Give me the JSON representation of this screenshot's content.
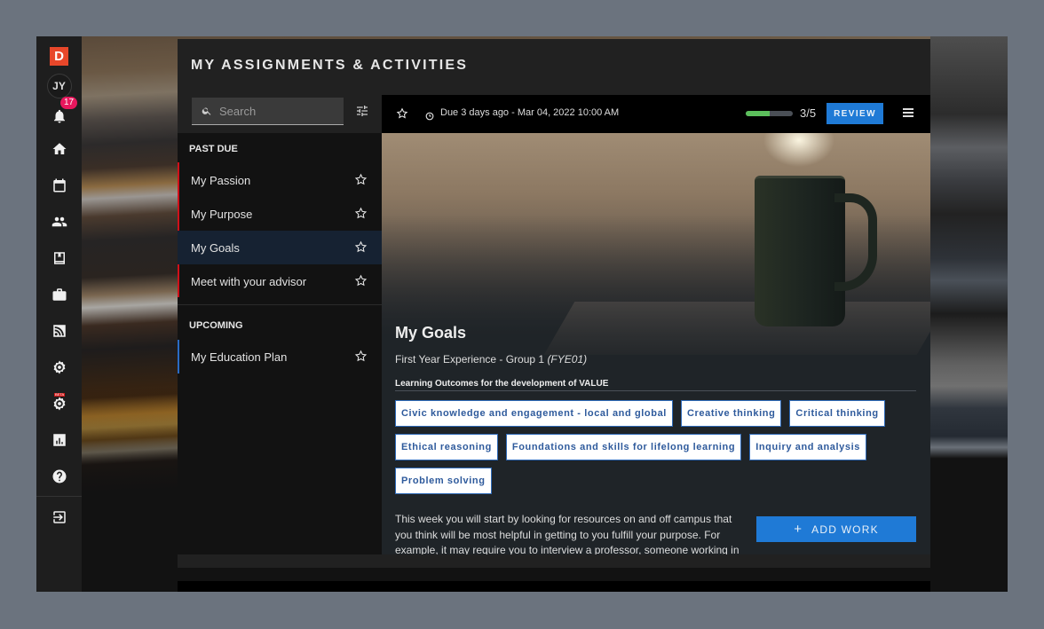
{
  "nav": {
    "logo": "D",
    "avatar": "JY",
    "notification_count": "17",
    "beta_label": "BETA",
    "items": [
      {
        "name": "home-icon"
      },
      {
        "name": "calendar-icon"
      },
      {
        "name": "people-icon"
      },
      {
        "name": "book-icon"
      },
      {
        "name": "briefcase-icon"
      },
      {
        "name": "rss-feed-icon"
      },
      {
        "name": "settings-icon"
      },
      {
        "name": "beta-settings-icon"
      },
      {
        "name": "analytics-icon"
      },
      {
        "name": "help-icon"
      },
      {
        "name": "logout-icon"
      }
    ]
  },
  "panel": {
    "title": "MY ASSIGNMENTS & ACTIVITIES"
  },
  "search": {
    "placeholder": "Search",
    "value": ""
  },
  "sections": {
    "past_due": {
      "label": "PAST DUE",
      "items": [
        {
          "label": "My Passion",
          "active": false
        },
        {
          "label": "My Purpose",
          "active": false
        },
        {
          "label": "My Goals",
          "active": true
        },
        {
          "label": "Meet with your advisor",
          "active": false
        }
      ]
    },
    "upcoming": {
      "label": "UPCOMING",
      "items": [
        {
          "label": "My Education Plan",
          "active": false
        }
      ]
    }
  },
  "detail": {
    "due_text": "Due 3 days ago - Mar 04, 2022 10:00 AM",
    "progress_label": "3/5",
    "progress_fill": 0.5,
    "review_label": "REVIEW",
    "title": "My Goals",
    "course": "First Year Experience - Group 1",
    "course_code": "(FYE01)",
    "outcomes_heading": "Learning Outcomes for the development of VALUE",
    "outcomes": [
      "Civic knowledge and engagement - local and global",
      "Creative thinking",
      "Critical thinking",
      "Ethical reasoning",
      "Foundations and skills for lifelong learning",
      "Inquiry and analysis",
      "Problem solving"
    ],
    "description": "This week you will start by looking for resources on and off campus that you think will be most helpful in getting to you fulfill your purpose. For example, it may require you to interview a professor, someone working in the city, or an expert in the field. Be resourceful and be creative.",
    "add_work_icon": "+",
    "add_work_label": "ADD WORK"
  },
  "colors": {
    "accent": "#1f7ad6",
    "past_due_bar": "#d0101a",
    "upcoming_bar": "#2a6bc4",
    "progress": "#5cbf5c",
    "badge": "#e8175d",
    "logo": "#e8472a"
  }
}
